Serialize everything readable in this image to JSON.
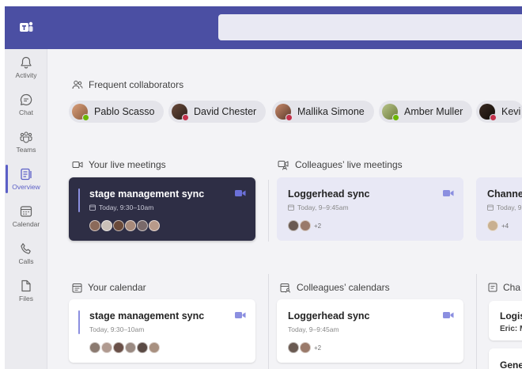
{
  "app": {
    "name": "Microsoft Teams"
  },
  "rail": {
    "items": [
      {
        "label": "Activity",
        "icon": "bell-icon"
      },
      {
        "label": "Chat",
        "icon": "chat-icon"
      },
      {
        "label": "Teams",
        "icon": "teams-icon"
      },
      {
        "label": "Overview",
        "icon": "overview-icon",
        "active": true
      },
      {
        "label": "Calendar",
        "icon": "calendar-icon"
      },
      {
        "label": "Calls",
        "icon": "phone-icon"
      },
      {
        "label": "Files",
        "icon": "file-icon"
      }
    ]
  },
  "collaborators": {
    "header": "Frequent collaborators",
    "people": [
      {
        "name": "Pablo Scasso",
        "status": "available"
      },
      {
        "name": "David Chester",
        "status": "busy"
      },
      {
        "name": "Mallika Simone",
        "status": "busy"
      },
      {
        "name": "Amber Muller",
        "status": "available"
      },
      {
        "name": "Kevi",
        "status": "busy"
      }
    ]
  },
  "live_meetings": {
    "header": "Your live meetings",
    "cards": [
      {
        "title": "stage management sync",
        "time": "Today, 9:30–10am"
      }
    ]
  },
  "colleagues_meetings": {
    "header": "Colleagues’ live meetings",
    "cards": [
      {
        "title": "Loggerhead sync",
        "time": "Today, 9–9:45am",
        "more": "+2"
      },
      {
        "title": "Channel p",
        "time": "Today, 9",
        "more": "+4"
      }
    ]
  },
  "your_calendar": {
    "header": "Your calendar",
    "cards": [
      {
        "title": "stage management sync",
        "time": "Today, 9:30–10am"
      }
    ]
  },
  "colleagues_calendars": {
    "header": "Colleagues’ calendars",
    "cards": [
      {
        "title": "Loggerhead sync",
        "time": "Today, 9–9:45am",
        "more": "+2"
      }
    ]
  },
  "channel_section": {
    "header": "Cha",
    "cards": [
      {
        "title": "Logist",
        "subtitle": "Eric: M"
      },
      {
        "title": "Gener"
      }
    ]
  },
  "colors": {
    "topbar": "#4b4fa3",
    "accent": "#5b5fc7",
    "dark_card": "#2e2e45"
  }
}
